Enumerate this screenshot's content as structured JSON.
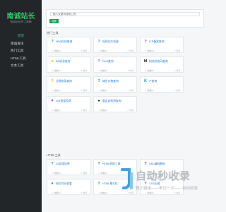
{
  "sidebar": {
    "title": "南诚站长",
    "subtitle": "南诚站长的工具箱",
    "items": [
      {
        "label": "首页"
      },
      {
        "label": "南诚资讯"
      },
      {
        "label": "热门工具"
      },
      {
        "label": "HTML工具"
      },
      {
        "label": "文本工具"
      }
    ]
  },
  "search": {
    "placeholder": "输入关键词搜索工具",
    "button_label": "搜索"
  },
  "sections": [
    {
      "title": "热门工具",
      "tiles": [
        {
          "name": "MD5在线查询",
          "icon": "?",
          "icon_color": "#12a55a",
          "stars": "☆ 收藏(0)",
          "visits": "↗ 访问"
        },
        {
          "name": "短网址生成器",
          "icon": "?",
          "icon_color": "#2a7dd4",
          "stars": "☆ 收藏(0)",
          "visits": "↗ 访问"
        },
        {
          "name": "ICP备案查询",
          "icon": "?",
          "icon_color": "#e0245e",
          "stars": "☆ 收藏(0)",
          "visits": "↗ 访问"
        },
        {
          "name": "BD收录查询",
          "icon": "●",
          "icon_color": "#f2b01e",
          "stars": "☆ 收藏(0)",
          "visits": "↗ 访问"
        },
        {
          "name": "DNS查询",
          "icon": "?",
          "icon_color": "#2a7dd4",
          "stars": "☆ 收藏(0)",
          "visits": "↗ 访问"
        },
        {
          "name": "网站状态码查询",
          "icon": "M",
          "icon_color": "#222222",
          "stars": "☆ 收藏(0)",
          "visits": "↗ 访问"
        },
        {
          "name": "谷歌收录查询",
          "icon": "?",
          "icon_color": "#f2b01e",
          "stars": "☆ 收藏(0)",
          "visits": "↗ 访问"
        },
        {
          "name": "域名价格查询",
          "icon": "?",
          "icon_color": "#2a7dd4",
          "stars": "☆ 收藏(0)",
          "visits": "↗ 访问"
        },
        {
          "name": "IP查询",
          "icon": "K",
          "icon_color": "#1aa3c7",
          "stars": "☆ 收藏(0)",
          "visits": "↗ 访问"
        },
        {
          "name": "404错误检测",
          "icon": "✦",
          "icon_color": "#8a4fd8",
          "stars": "☆ 收藏(0)",
          "visits": "↗ 访问"
        },
        {
          "name": "重定向检测查询",
          "icon": "●",
          "icon_color": "#222222",
          "stars": "☆ 收藏(0)",
          "visits": "↗ 访问"
        }
      ]
    },
    {
      "title": "HTML工具",
      "tiles": [
        {
          "name": "JS混淆加密",
          "icon": "?",
          "icon_color": "#12a55a",
          "stars": "☆ 收藏(0)",
          "visits": "↗ 访问"
        },
        {
          "name": "HTML转换工具",
          "icon": "?",
          "icon_color": "#2a7dd4",
          "stars": "☆ 收藏(0)",
          "visits": "↗ 访问"
        },
        {
          "name": "URL编码解码",
          "icon": "?",
          "icon_color": "#e0245e",
          "stars": "☆ 收藏(0)",
          "visits": "↗ 访问"
        },
        {
          "name": "网页代码查看",
          "icon": "●",
          "icon_color": "#2a7dd4",
          "stars": "☆ 收藏(0)",
          "visits": "↗ 访问"
        },
        {
          "name": "HTML格式化",
          "icon": "?",
          "icon_color": "#12a55a",
          "stars": "☆ 收藏(0)",
          "visits": "↗ 访问"
        },
        {
          "name": "CSS压缩",
          "icon": "?",
          "icon_color": "#8a4fd8",
          "stars": "☆ 收藏(0)",
          "visits": "↗ 访问"
        }
      ]
    }
  ],
  "watermark": {
    "title": "自动秒收录",
    "subtitle": "做上链接——来访一次——自动收录"
  }
}
